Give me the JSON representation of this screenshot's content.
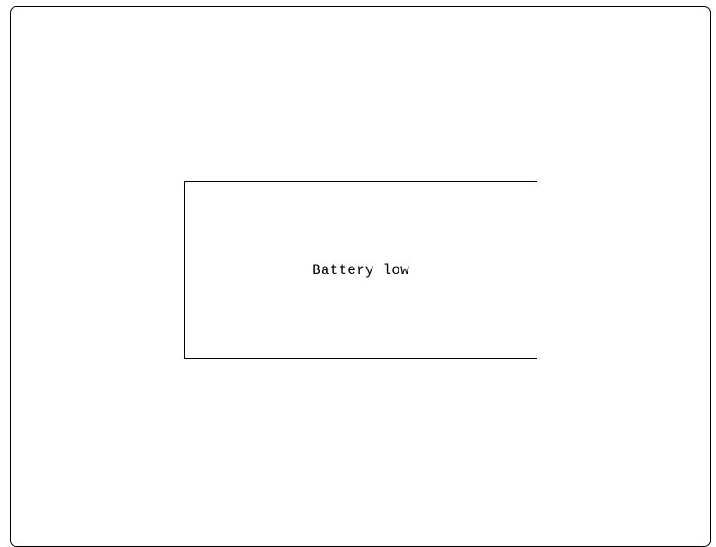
{
  "dialog": {
    "message": "Battery low"
  },
  "colors": {
    "background": "#ffffff",
    "border": "#000000",
    "text": "#000000"
  }
}
